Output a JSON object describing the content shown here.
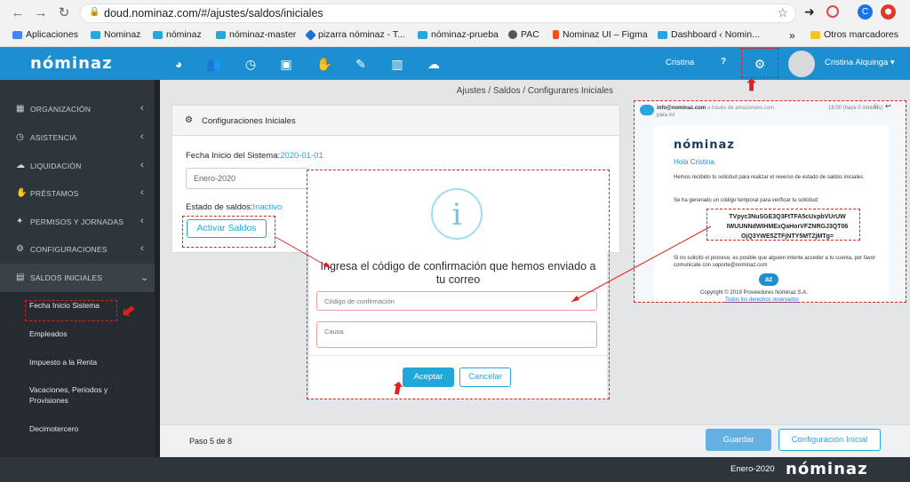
{
  "browser": {
    "url": "doud.nominaz.com/#/ajustes/saldos/iniciales",
    "profile_initial": "C",
    "bookmarks": [
      {
        "label": "Aplicaciones",
        "color": "#4285f4"
      },
      {
        "label": "Nominaz",
        "color": "#2aa6df"
      },
      {
        "label": "nóminaz",
        "color": "#2aa6df"
      },
      {
        "label": "nóminaz-master",
        "color": "#2aa6df"
      },
      {
        "label": "pizarra nóminaz - T...",
        "color": "#1e6fd9"
      },
      {
        "label": "nóminaz-prueba",
        "color": "#2aa6df"
      },
      {
        "label": "PAC",
        "color": "#555555"
      },
      {
        "label": "Nominaz UI – Figma",
        "color": "#f24e1e"
      },
      {
        "label": "Dashboard ‹ Nomin...",
        "color": "#2aa6df"
      }
    ],
    "overflow": "»",
    "other_bookmarks": "Otros marcadores"
  },
  "app": {
    "logo": "nóminaz",
    "header_user_short": "Cristina",
    "help": "?",
    "user_name": "Cristina Alquinga",
    "breadcrumb": "Ajustes / Saldos / Configurares Iniciales"
  },
  "sidebar": {
    "items": [
      {
        "label": "ORGANIZACIÓN",
        "icon": "▦"
      },
      {
        "label": "ASISTENCIA",
        "icon": "◷"
      },
      {
        "label": "LIQUIDACIÓN",
        "icon": "☁"
      },
      {
        "label": "PRÉSTAMOS",
        "icon": "✋"
      },
      {
        "label": "PERMISOS Y JORNADAS",
        "icon": "✦"
      },
      {
        "label": "CONFIGURACIONES",
        "icon": "⚙"
      },
      {
        "label": "SALDOS INICIALES",
        "icon": "▤"
      }
    ],
    "subitems": [
      {
        "label": "Fecha Inicio Sistema"
      },
      {
        "label": "Empleados"
      },
      {
        "label": "Impuesto a la Renta"
      },
      {
        "label": "Vacaciones, Periodos y Provisiones"
      },
      {
        "label": "Decimotercero"
      }
    ]
  },
  "card": {
    "title": "Configuraciones Iniciales",
    "fecha_label": "Fecha Inicio del Sistema:",
    "fecha_value": "2020-01-01",
    "select_value": "Enero-2020",
    "estado_label": "Estado de saldos:",
    "estado_value": "Inactivo",
    "activar_button": "Activar Saldos"
  },
  "modal": {
    "icon": "i",
    "message": "Ingresa el código de confirmación que hemos enviado a tu correo",
    "code_placeholder": "Código de confirmación",
    "causa_placeholder": "Causa",
    "accept": "Aceptar",
    "cancel": "Cancelar"
  },
  "email": {
    "from": "info@nominaz.com",
    "from_via": "a través de amazonses.com",
    "to": "para mí",
    "time": "18:00 (hace 0 minutos)",
    "logo": "nóminaz",
    "greeting": "Hola Cristina.",
    "body1": "Hemos recibido tu solicitud para realizar el reverso de estado de saldos iniciales.",
    "body2": "Se ha generado un código temporal para verificar tu solicitud:",
    "code_lines": [
      "TVpyc3NuSGE3Q3FtTFA5cUxpbVUrUW",
      "IWUUNNdWIHMExQaHorVFZNRGJ3QT06",
      "OjQ3YWE5ZTFjNTY5MTZjMTg="
    ],
    "footer_note": "Si no solicitó el proceso, es posible que alguien intente acceder a tu cuenta, por favor comunicate con soporte@nominaz.com",
    "footer_logo": "az",
    "copyright": "Copyright © 2019 Proveedores Nóminaz S.A.",
    "rights": "Todos los derechos reservados"
  },
  "footer": {
    "step": "Paso 5 de 8",
    "save": "Guardar",
    "config": "Configuración Inicial",
    "period": "Enero-2020",
    "logo": "nóminaz"
  },
  "colors": {
    "header_blue": "#1b8fd0",
    "accent": "#20a8d8",
    "sidebar": "#2f353d",
    "annotation_red": "#e0201c"
  }
}
